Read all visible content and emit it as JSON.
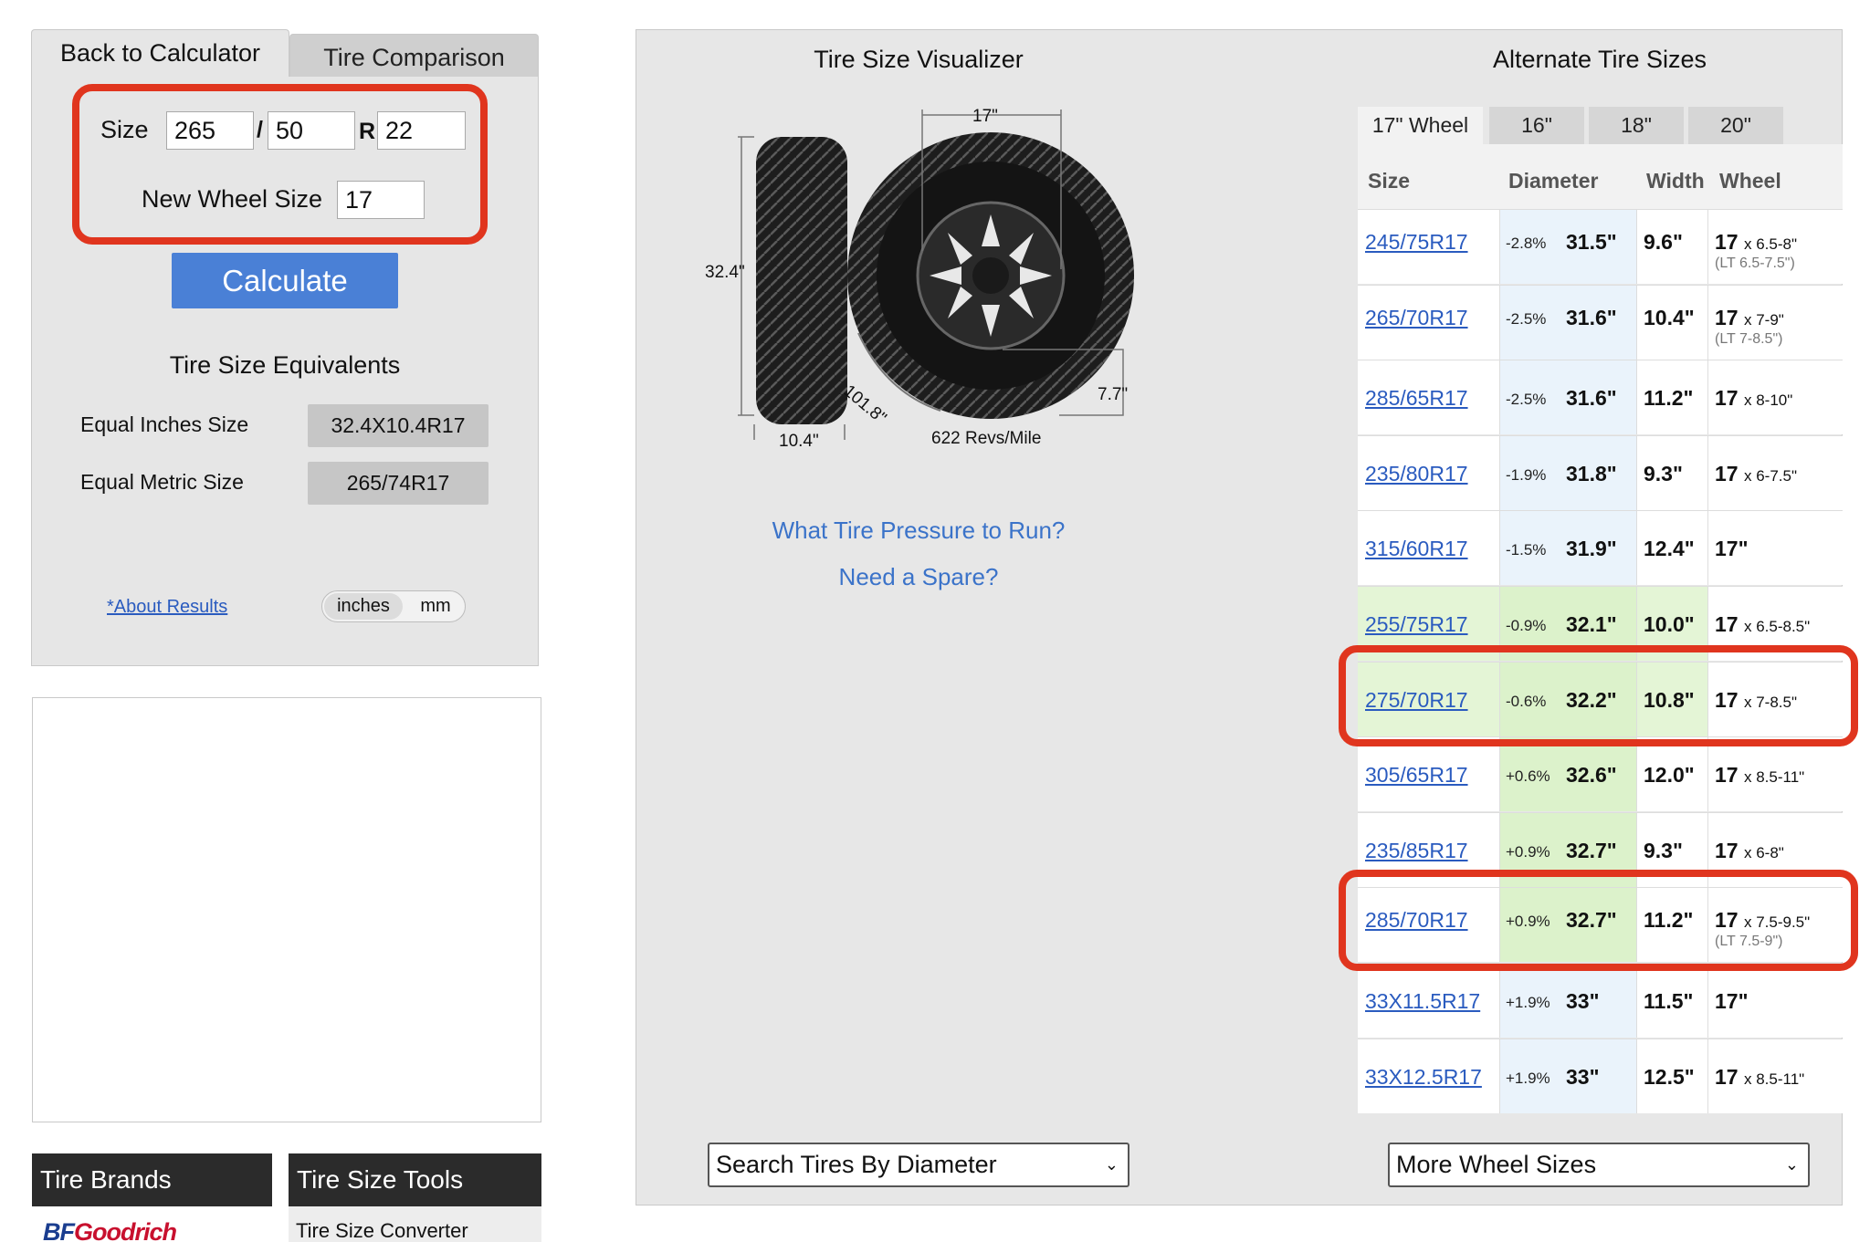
{
  "calculator": {
    "tabs": [
      "Back to Calculator",
      "Tire Comparison"
    ],
    "size_label": "Size",
    "width_value": "265",
    "aspect_value": "50",
    "r_label": "R",
    "rim_value": "22",
    "slash": "/",
    "new_wheel_label": "New Wheel Size",
    "new_wheel_value": "17",
    "calculate_label": "Calculate",
    "equivalents_title": "Tire Size Equivalents",
    "equal_inches_label": "Equal Inches Size",
    "equal_inches_value": "32.4X10.4R17",
    "equal_metric_label": "Equal Metric Size",
    "equal_metric_value": "265/74R17",
    "about_link": "*About Results",
    "units": [
      "inches",
      "mm"
    ],
    "selected_unit": "inches"
  },
  "bottom_nav": {
    "brands_header": "Tire Brands",
    "tools_header": "Tire Size Tools",
    "brand_logo": "BFGoodrich",
    "tools_item": "Tire Size Converter"
  },
  "visualizer": {
    "title": "Tire Size Visualizer",
    "rim_dim": "17\"",
    "diameter_dim": "32.4\"",
    "width_dim": "10.4\"",
    "circumference_dim": "101.8\"",
    "sidewall_dim": "7.7\"",
    "revs": "622 Revs/Mile",
    "pressure_link": "What Tire Pressure to Run?",
    "spare_link": "Need a Spare?",
    "search_select": "Search Tires By Diameter"
  },
  "alternates": {
    "title": "Alternate Tire Sizes",
    "wheel_tabs": [
      "17\" Wheel",
      "16\"",
      "18\"",
      "20\""
    ],
    "columns": [
      "Size",
      "Diameter",
      "Width",
      "Wheel"
    ],
    "rows": [
      {
        "size": "245/75R17",
        "pct": "-2.8%",
        "diameter": "31.5\"",
        "width": "9.6\"",
        "wheel": "17",
        "wheel_range": "x 6.5-8\"",
        "lt": "(LT 6.5-7.5\")",
        "highlight": "none"
      },
      {
        "size": "265/70R17",
        "pct": "-2.5%",
        "diameter": "31.6\"",
        "width": "10.4\"",
        "wheel": "17",
        "wheel_range": "x 7-9\"",
        "lt": "(LT 7-8.5\")",
        "highlight": "none"
      },
      {
        "size": "285/65R17",
        "pct": "-2.5%",
        "diameter": "31.6\"",
        "width": "11.2\"",
        "wheel": "17",
        "wheel_range": "x 8-10\"",
        "lt": "",
        "highlight": "none"
      },
      {
        "size": "235/80R17",
        "pct": "-1.9%",
        "diameter": "31.8\"",
        "width": "9.3\"",
        "wheel": "17",
        "wheel_range": "x 6-7.5\"",
        "lt": "",
        "highlight": "none"
      },
      {
        "size": "315/60R17",
        "pct": "-1.5%",
        "diameter": "31.9\"",
        "width": "12.4\"",
        "wheel": "17\"",
        "wheel_range": "",
        "lt": "",
        "highlight": "none"
      },
      {
        "size": "255/75R17",
        "pct": "-0.9%",
        "diameter": "32.1\"",
        "width": "10.0\"",
        "wheel": "17",
        "wheel_range": "x 6.5-8.5\"",
        "lt": "",
        "highlight": "green"
      },
      {
        "size": "275/70R17",
        "pct": "-0.6%",
        "diameter": "32.2\"",
        "width": "10.8\"",
        "wheel": "17",
        "wheel_range": "x 7-8.5\"",
        "lt": "",
        "highlight": "green"
      },
      {
        "size": "305/65R17",
        "pct": "+0.6%",
        "diameter": "32.6\"",
        "width": "12.0\"",
        "wheel": "17",
        "wheel_range": "x 8.5-11\"",
        "lt": "",
        "highlight": "diam"
      },
      {
        "size": "235/85R17",
        "pct": "+0.9%",
        "diameter": "32.7\"",
        "width": "9.3\"",
        "wheel": "17",
        "wheel_range": "x 6-8\"",
        "lt": "",
        "highlight": "diam"
      },
      {
        "size": "285/70R17",
        "pct": "+0.9%",
        "diameter": "32.7\"",
        "width": "11.2\"",
        "wheel": "17",
        "wheel_range": "x 7.5-9.5\"",
        "lt": "(LT 7.5-9\")",
        "highlight": "diam"
      },
      {
        "size": "33X11.5R17",
        "pct": "+1.9%",
        "diameter": "33\"",
        "width": "11.5\"",
        "wheel": "17\"",
        "wheel_range": "",
        "lt": "",
        "highlight": "none"
      },
      {
        "size": "33X12.5R17",
        "pct": "+1.9%",
        "diameter": "33\"",
        "width": "12.5\"",
        "wheel": "17",
        "wheel_range": "x 8.5-11\"",
        "lt": "",
        "highlight": "none"
      }
    ],
    "more_select": "More Wheel Sizes"
  }
}
